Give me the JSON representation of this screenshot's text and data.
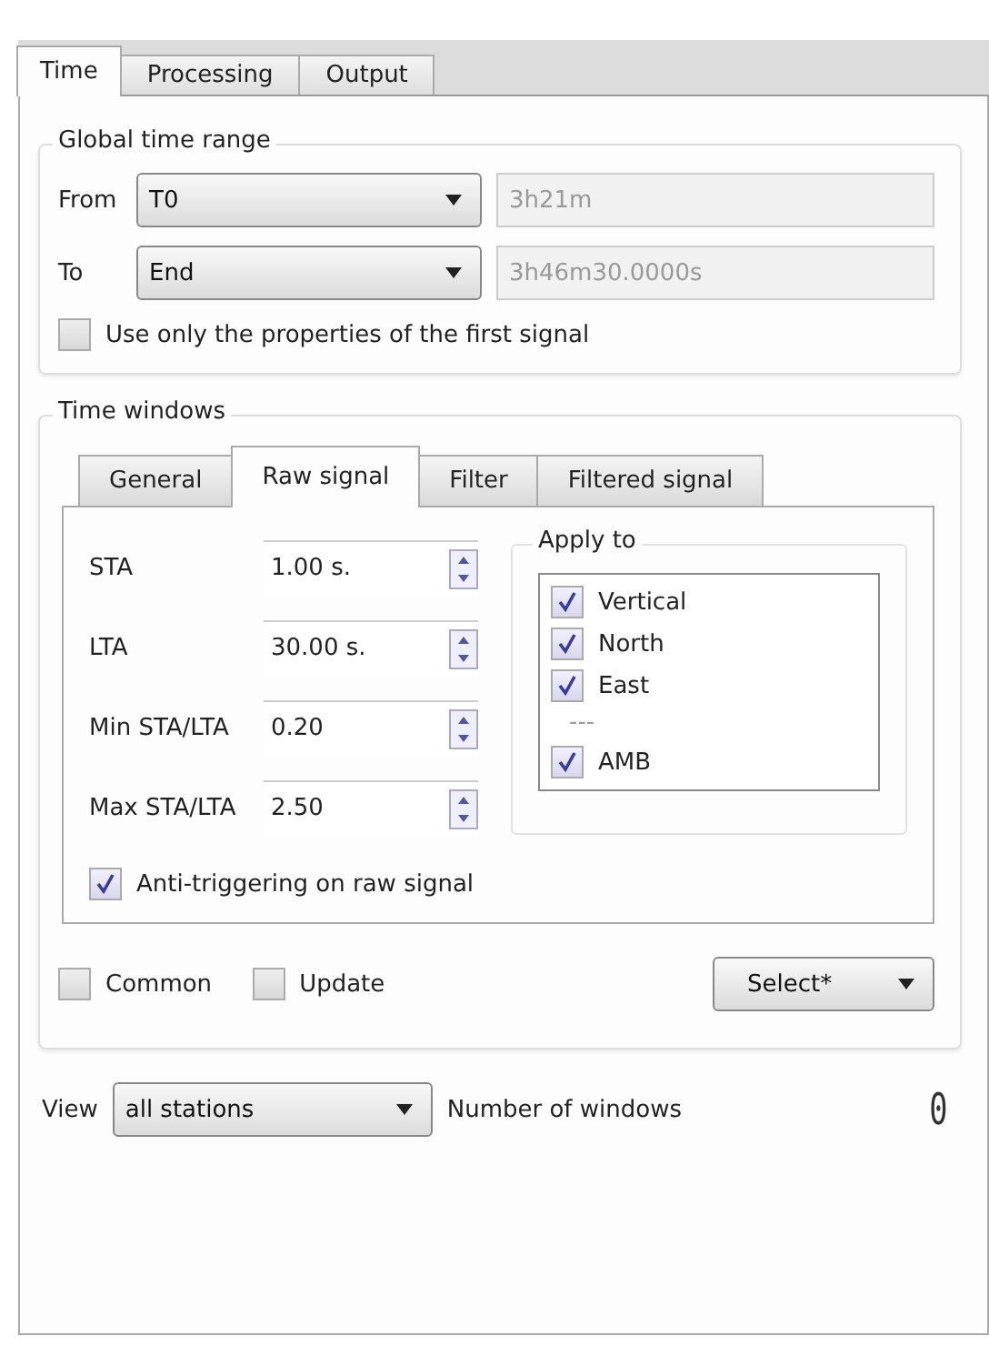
{
  "tabs": [
    {
      "label": "Time",
      "selected": true
    },
    {
      "label": "Processing",
      "selected": false
    },
    {
      "label": "Output",
      "selected": false
    }
  ],
  "global_time_range": {
    "title": "Global time range",
    "rows": [
      {
        "label": "From",
        "combo": "T0",
        "value": "3h21m"
      },
      {
        "label": "To",
        "combo": "End",
        "value": "3h46m30.0000s"
      }
    ],
    "first_signal": {
      "label": "Use only the properties of the first signal",
      "checked": false
    }
  },
  "time_windows": {
    "title": "Time windows",
    "tabs": [
      {
        "label": "General",
        "selected": false
      },
      {
        "label": "Raw signal",
        "selected": true
      },
      {
        "label": "Filter",
        "selected": false
      },
      {
        "label": "Filtered signal",
        "selected": false
      }
    ],
    "fields": [
      {
        "label": "STA",
        "value": "1.00 s."
      },
      {
        "label": "LTA",
        "value": "30.00 s."
      },
      {
        "label": "Min STA/LTA",
        "value": "0.20"
      },
      {
        "label": "Max STA/LTA",
        "value": "2.50"
      }
    ],
    "apply_to": {
      "title": "Apply to",
      "items": [
        {
          "kind": "check",
          "label": "Vertical",
          "checked": true
        },
        {
          "kind": "check",
          "label": "North",
          "checked": true
        },
        {
          "kind": "check",
          "label": "East",
          "checked": true
        },
        {
          "kind": "separator",
          "label": "---"
        },
        {
          "kind": "check",
          "label": "AMB",
          "checked": true
        }
      ]
    },
    "anti_triggering": {
      "label": "Anti-triggering on raw signal",
      "checked": true
    },
    "common": {
      "label": "Common",
      "checked": false
    },
    "update": {
      "label": "Update",
      "checked": false
    },
    "select_button": "Select*"
  },
  "view": {
    "label": "View",
    "combo": "all stations",
    "count_label": "Number of windows",
    "count": "0"
  }
}
